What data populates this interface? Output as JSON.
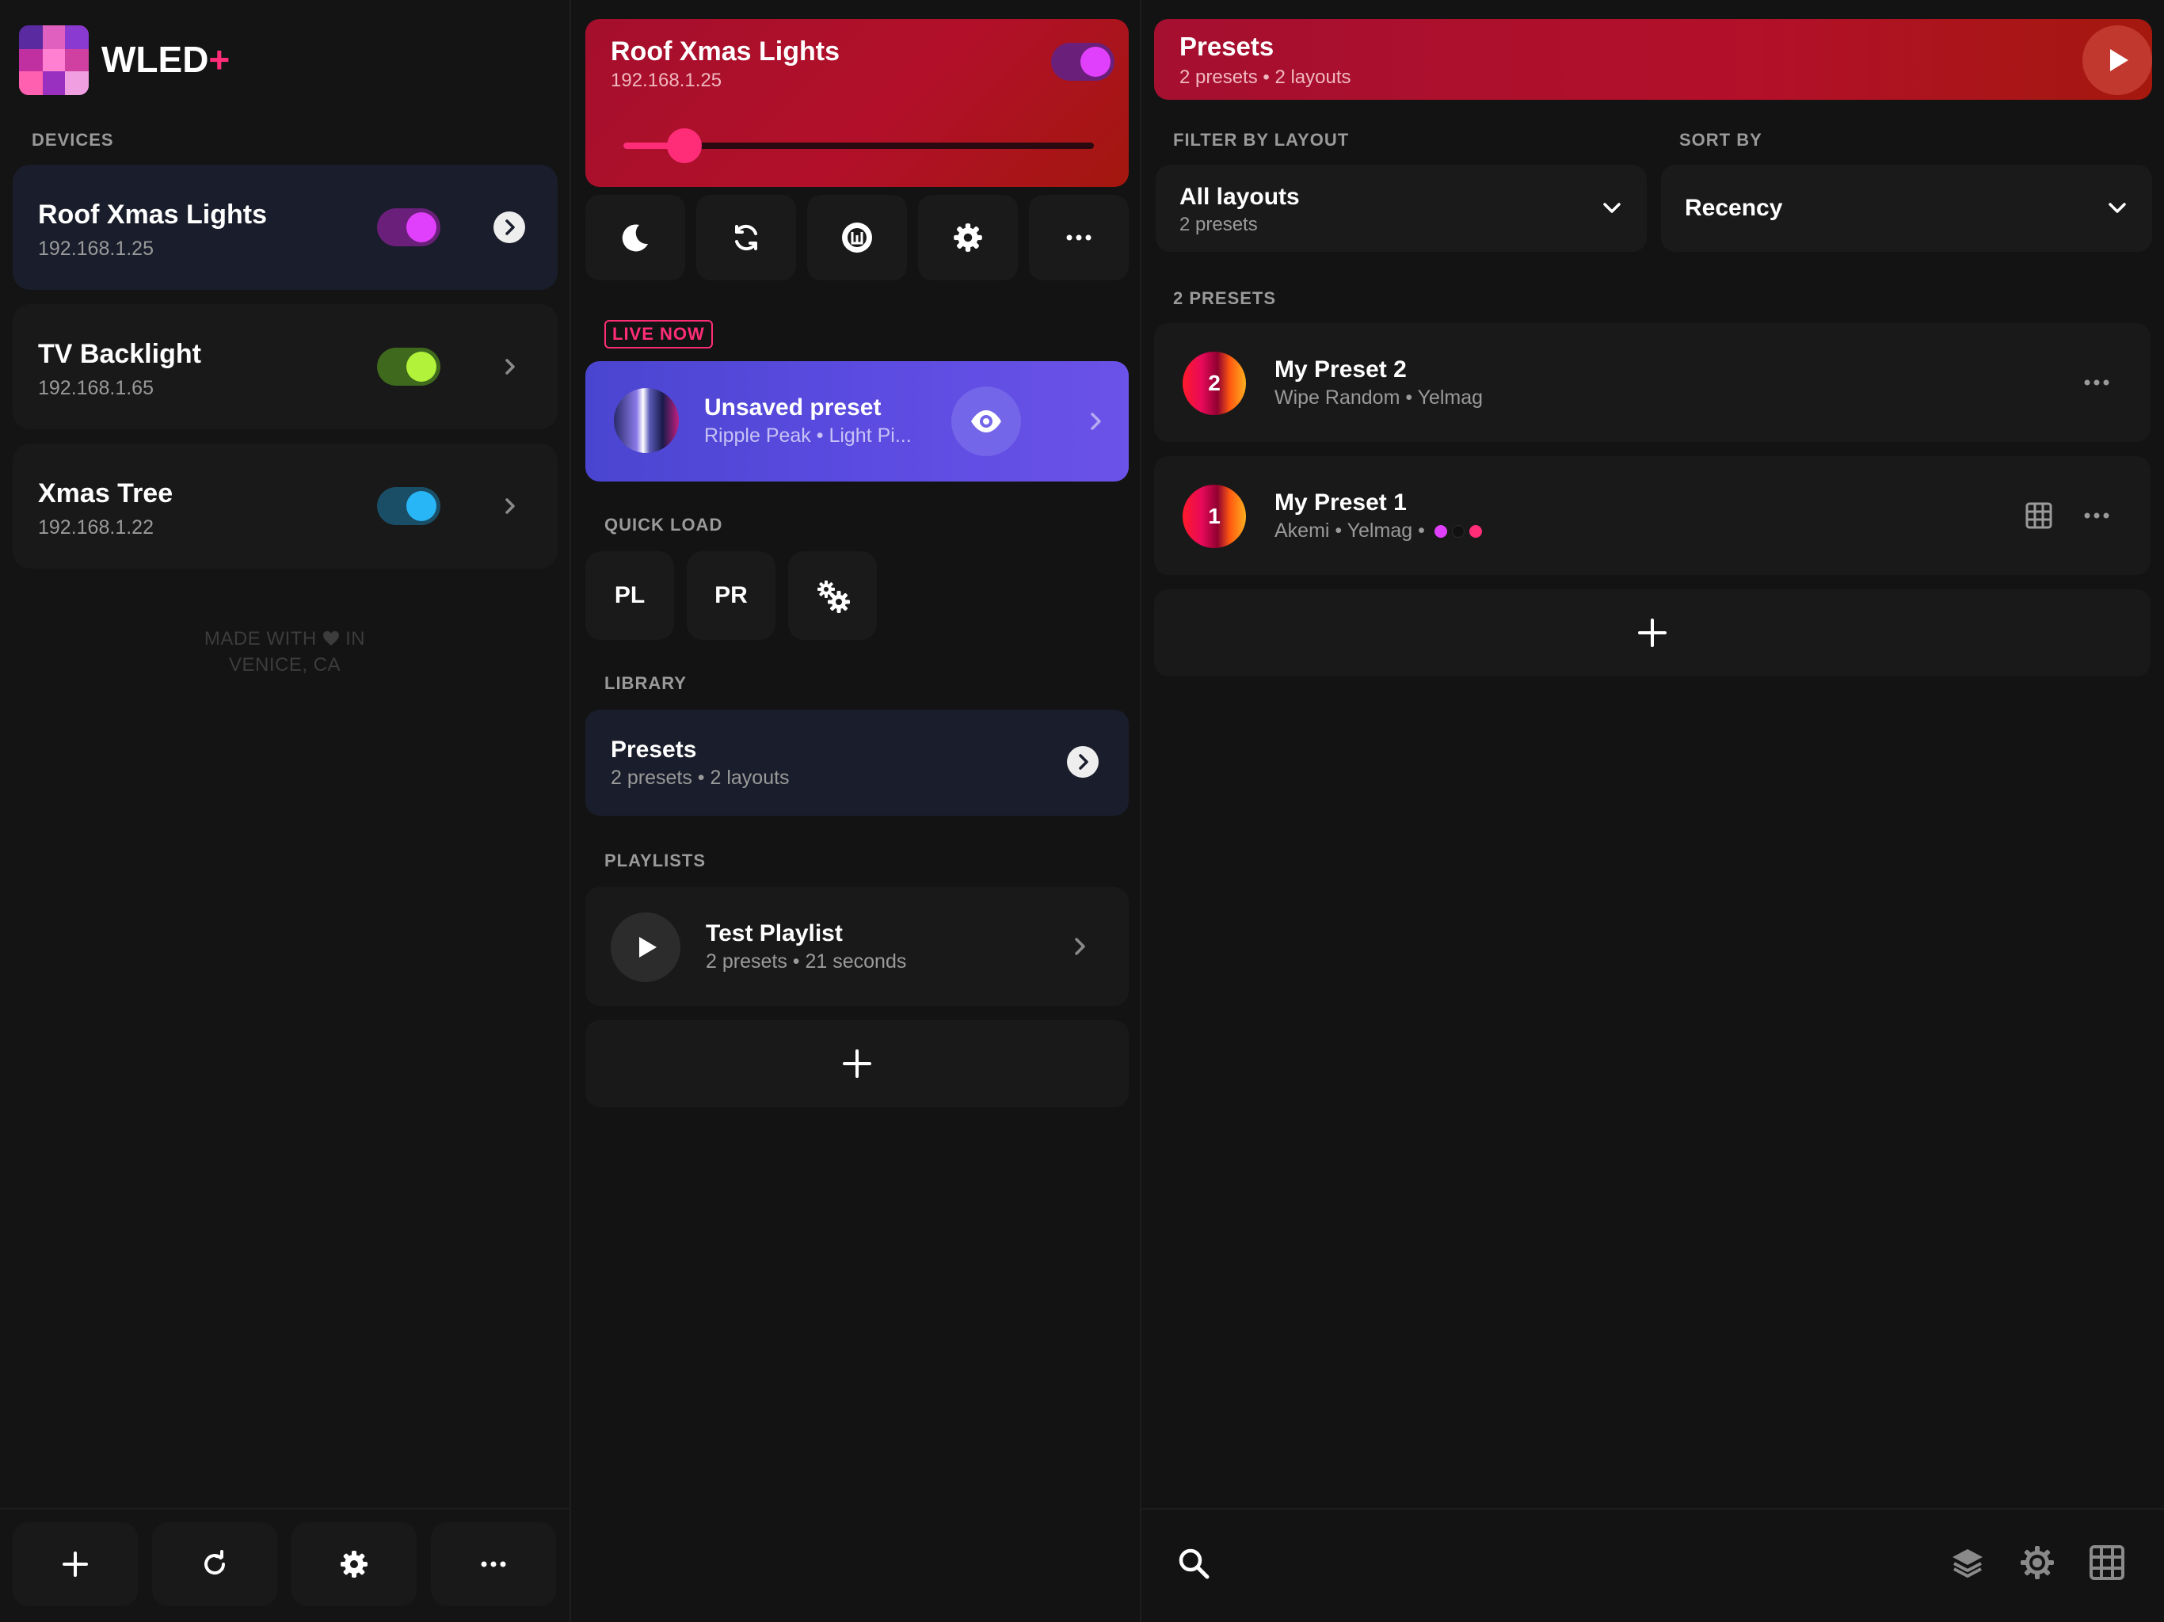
{
  "app": {
    "name": "WLED",
    "name_plus": "+"
  },
  "sidebar": {
    "devices_label": "DEVICES",
    "devices": [
      {
        "name": "Roof Xmas Lights",
        "ip": "192.168.1.25",
        "on": true,
        "color": "#e040fb",
        "track": "#6a1f7a",
        "active": true
      },
      {
        "name": "TV Backlight",
        "ip": "192.168.1.65",
        "on": true,
        "color": "#b2f23a",
        "track": "#3f6a1e",
        "active": false
      },
      {
        "name": "Xmas Tree",
        "ip": "192.168.1.22",
        "on": true,
        "color": "#29b6f6",
        "track": "#1a4e66",
        "active": false
      }
    ],
    "made_with_line1": "MADE WITH",
    "made_with_in": "IN",
    "made_with_line2": "VENICE, CA",
    "bottom_buttons": [
      "add-icon",
      "refresh-icon",
      "gear-icon",
      "more-icon"
    ]
  },
  "device_panel": {
    "name": "Roof Xmas Lights",
    "ip": "192.168.1.25",
    "on": true,
    "brightness": 0.13,
    "controls": [
      "moon-icon",
      "sync-icon",
      "wled-icon",
      "gear-icon",
      "more-icon"
    ],
    "live_now_label": "LIVE NOW",
    "live": {
      "title": "Unsaved preset",
      "subtitle": "Ripple Peak • Light Pi..."
    },
    "quick_load_label": "QUICK LOAD",
    "quick_load": [
      "PL",
      "PR"
    ],
    "library_label": "LIBRARY",
    "library": {
      "title": "Presets",
      "subtitle": "2 presets • 2 layouts"
    },
    "playlists_label": "PLAYLISTS",
    "playlist": {
      "title": "Test Playlist",
      "subtitle": "2 presets • 21 seconds"
    }
  },
  "presets_panel": {
    "title": "Presets",
    "subtitle": "2 presets • 2 layouts",
    "filter_label": "FILTER BY LAYOUT",
    "filter": {
      "value": "All layouts",
      "sub": "2 presets"
    },
    "sort_label": "SORT BY",
    "sort": {
      "value": "Recency"
    },
    "count_label": "2 PRESETS",
    "presets": [
      {
        "number": "2",
        "name": "My Preset 2",
        "sub": "Wipe Random • Yelmag"
      },
      {
        "number": "1",
        "name": "My Preset 1",
        "sub": "Akemi • Yelmag •",
        "colors": [
          "#e040fb",
          "#111111",
          "#ff2d78"
        ]
      }
    ]
  },
  "colors": {
    "accent": "#ff2d78",
    "header_red": "#b2102a",
    "live_purple": "#5b4be0"
  }
}
